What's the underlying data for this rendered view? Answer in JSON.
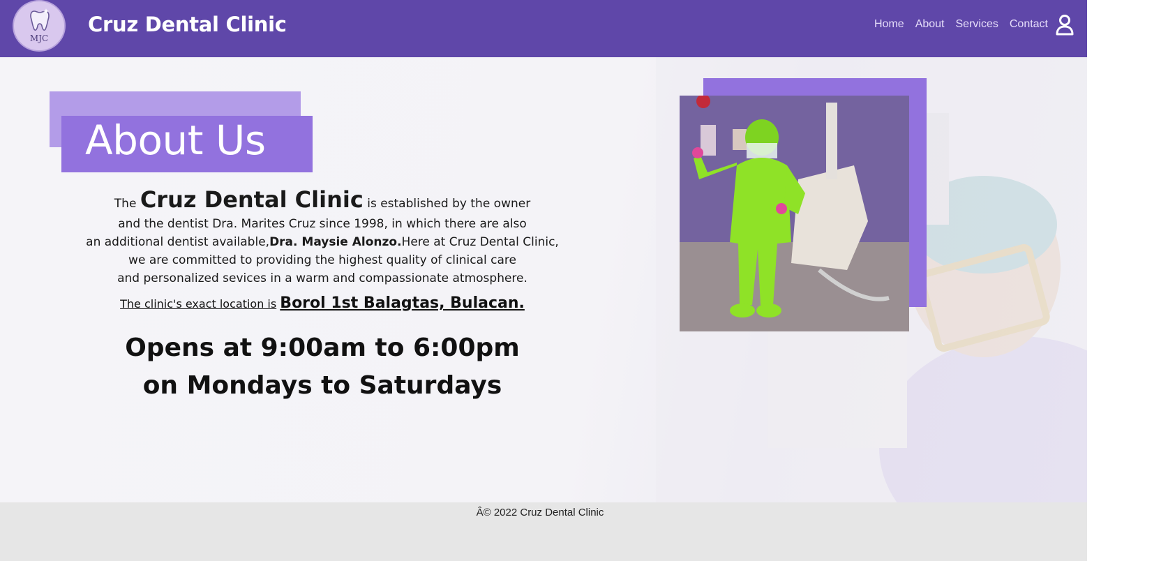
{
  "nav": {
    "logo_text": "MJC",
    "brand": "Cruz Dental Clinic",
    "links": [
      "Home",
      "About",
      "Services",
      "Contact"
    ]
  },
  "about": {
    "heading": "About Us",
    "intro_prefix": "The",
    "intro_name": "Cruz Dental Clinic",
    "intro_suffix": "is established by the owner",
    "line2": "and the dentist Dra. Marites Cruz since 1998, in which there are also",
    "line3_prefix": "an additional dentist available,",
    "line3_bold": "Dra. Maysie Alonzo.",
    "line3_suffix": "Here at Cruz Dental Clinic,",
    "line4": "we are committed to providing the highest quality of clinical care",
    "line5": "and personalized sevices in a warm and compassionate atmosphere.",
    "location_label": "The clinic's exact location is",
    "location_place": "Borol 1st Balagtas, Bulacan.",
    "hours_line1": "Opens at 9:00am to 6:00pm",
    "hours_line2": "on Mondays to Saturdays"
  },
  "footer": {
    "text": "Â© 2022 Cruz Dental Clinic"
  },
  "colors": {
    "navbar": "#5f47a9",
    "accent": "#9272de",
    "accent_light": "#b39ce8",
    "footer": "#e6e6e6"
  },
  "icons": {
    "logo": "tooth-icon",
    "account": "user-icon"
  }
}
